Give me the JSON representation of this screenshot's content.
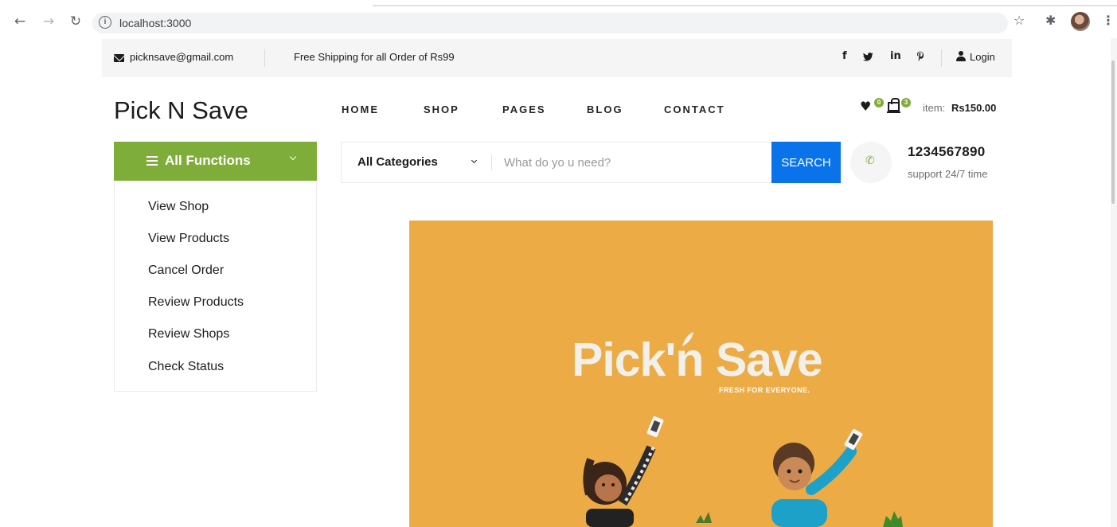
{
  "browser": {
    "url": "localhost:3000",
    "icons": [
      "back-arrow-icon",
      "forward-arrow-icon",
      "reload-icon",
      "info-icon",
      "star-icon",
      "extensions-icon",
      "profile-avatar",
      "more-menu-icon"
    ]
  },
  "topbar": {
    "email": "picknsave@gmail.com",
    "shipping": "Free Shipping for all Order of Rs99",
    "social": [
      "f",
      "in"
    ],
    "login_label": "Login"
  },
  "header": {
    "logo": "Pick N Save",
    "menu": [
      "HOME",
      "SHOP",
      "PAGES",
      "BLOG",
      "CONTACT"
    ],
    "wishlist_count": "0",
    "cart_count": "3",
    "item_label": "item:",
    "item_price": "Rs150.00"
  },
  "functions": {
    "title": "All Functions",
    "items": [
      "View Shop",
      "View Products",
      "Cancel Order",
      "Review Products",
      "Review Shops",
      "Check Status"
    ]
  },
  "search": {
    "category": "All Categories",
    "placeholder": "What do yo u need?",
    "button_label": "SEARCH"
  },
  "contact": {
    "phone": "1234567890",
    "support": "support 24/7 time"
  },
  "hero": {
    "brand": "Pick'n Save",
    "tagline": "FRESH FOR EVERYONE."
  },
  "colors": {
    "accent_green": "#7fad39",
    "search_blue": "#0b73ea",
    "hero_bg": "#ecab45"
  }
}
